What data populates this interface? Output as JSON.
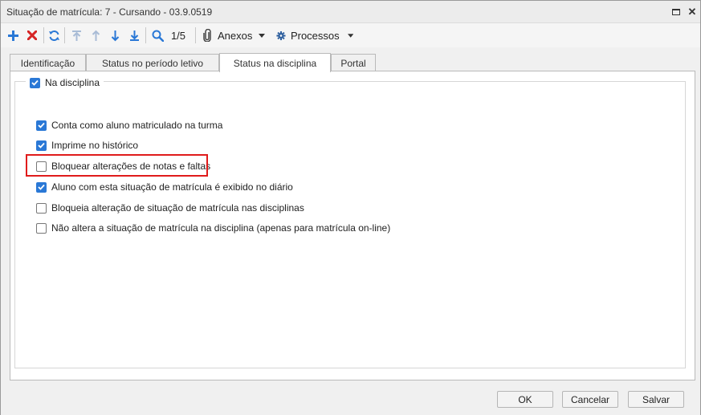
{
  "window": {
    "title": "Situação de matrícula: 7 - Cursando - 03.9.0519"
  },
  "toolbar": {
    "page_indicator": "1/5",
    "anexos_label": "Anexos",
    "processos_label": "Processos"
  },
  "tabs": [
    {
      "label": "Identificação",
      "active": false
    },
    {
      "label": "Status no período letivo",
      "active": false
    },
    {
      "label": "Status na disciplina",
      "active": true
    },
    {
      "label": "Portal",
      "active": false
    }
  ],
  "group": {
    "label": "Na disciplina",
    "checked": true
  },
  "options": [
    {
      "label": "Conta como aluno matriculado na turma",
      "checked": true
    },
    {
      "label": "Imprime no histórico",
      "checked": true
    },
    {
      "label": "Bloquear alterações de notas e faltas",
      "checked": false
    },
    {
      "label": "Aluno com esta situação de matrícula é exibido no diário",
      "checked": true
    },
    {
      "label": "Bloqueia alteração de situação de matrícula nas disciplinas",
      "checked": false
    },
    {
      "label": "Não altera a situação de matrícula na disciplina (apenas para matrícula on-line)",
      "checked": false
    }
  ],
  "buttons": {
    "ok": "OK",
    "cancel": "Cancelar",
    "save": "Salvar"
  },
  "colors": {
    "accent": "#2a78d6",
    "highlight": "#e01b1b"
  }
}
